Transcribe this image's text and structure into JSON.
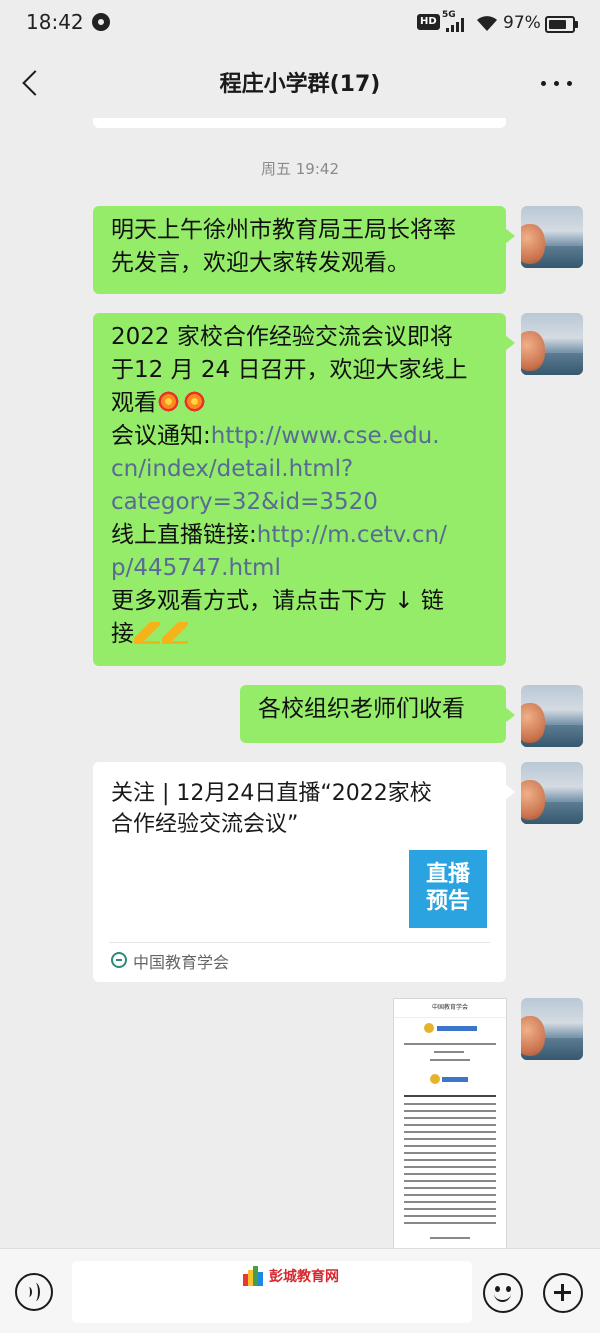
{
  "status_bar": {
    "time": "18:42",
    "hd": "HD",
    "network": "5G",
    "battery_percent": "97%",
    "battery_level": 0.97
  },
  "header": {
    "title": "程庄小学群(17)"
  },
  "chat": {
    "timestamp": "周五 19:42",
    "messages": [
      {
        "type": "text",
        "lines": [
          "明天上午徐州市教育局王局长将率",
          "先发言，欢迎大家转发观看。"
        ]
      },
      {
        "type": "text",
        "line1": "2022 家校合作经验交流会议即将",
        "line2": "于12 月 24 日召开，欢迎大家线上",
        "line3": "观看",
        "line4_label": "会议通知:",
        "line4_link": "http://www.cse.edu.",
        "line5_link": "cn/index/detail.html?",
        "line6_link": "category=32&id=3520",
        "line7_label": "线上直播链接:",
        "line7_link": "http://m.cetv.cn/",
        "line8_link": "p/445747.html",
        "line9": "更多观看方式，请点击下方 ↓ 链",
        "line10": "接"
      },
      {
        "type": "text",
        "lines": [
          "各校组织老师们收看"
        ]
      },
      {
        "type": "link_card",
        "title_lines": [
          "关注 | 12月24日直播“2022家校",
          "合作经验交流会议”"
        ],
        "thumb_lines": [
          "直播",
          "预告"
        ],
        "source": "中国教育学会"
      },
      {
        "type": "image",
        "header": "中国教育学会"
      }
    ]
  },
  "watermark": {
    "text": "彭城教育网"
  },
  "input": {
    "placeholder": ""
  },
  "colors": {
    "sent_bubble": "#95ec69",
    "link": "#576b95",
    "background": "#ededed",
    "thumb_blue": "#2aa3e0",
    "watermark_red": "#d7282f"
  },
  "icons": {
    "back": "chevron-left-icon",
    "more": "more-dots-icon",
    "voice": "voice-icon",
    "emoji": "emoji-icon",
    "plus": "plus-icon",
    "settings": "gear-icon",
    "wifi": "wifi-icon",
    "signal": "signal-icon",
    "battery": "battery-icon"
  }
}
